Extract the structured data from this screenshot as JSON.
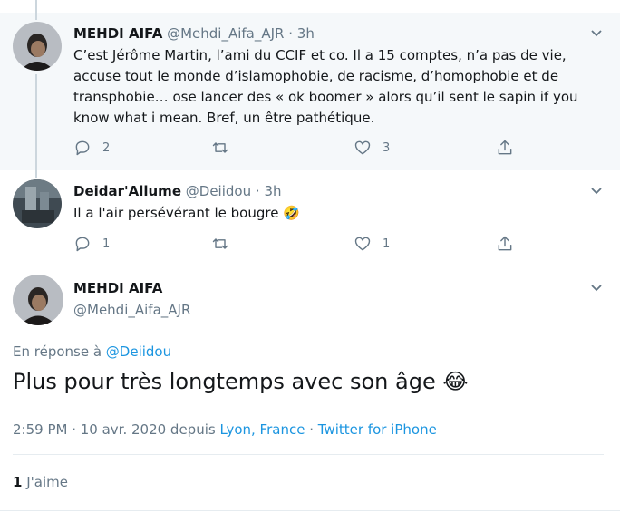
{
  "tweets": [
    {
      "name": "MEHDI AIFA",
      "handle": "@Mehdi_Aifa_AJR",
      "time": "3h",
      "text": "C’est Jérôme Martin, l’ami du CCIF et co. Il a 15 comptes, n’a pas de vie, accuse tout le monde d’islamophobie, de racisme, d’homophobie et de transphobie… ose lancer des « ok boomer » alors qu’il sent le sapin if you know what i mean. Bref, un être pathétique.",
      "replies": "2",
      "retweets": "",
      "likes": "3"
    },
    {
      "name": "Deidar'Allume",
      "handle": "@Deiidou",
      "time": "3h",
      "text": "Il a l'air persévérant le bougre",
      "emoji": "🤣",
      "replies": "1",
      "retweets": "",
      "likes": "1"
    }
  ],
  "main": {
    "name": "MEHDI AIFA",
    "handle": "@Mehdi_Aifa_AJR",
    "reply_prefix": "En réponse à ",
    "reply_mention": "@Deiidou",
    "text": "Plus pour très longtemps avec son âge",
    "emoji": "😂",
    "timestamp": "2:59 PM · 10 avr. 2020 depuis ",
    "location": "Lyon, France",
    "separator": " · ",
    "source": "Twitter for iPhone",
    "like_count": "1",
    "like_label": "J'aime"
  },
  "colors": {
    "accent": "#1b95e0",
    "muted": "#657786",
    "highlight_bg": "#f5f8fa"
  },
  "icons": [
    "reply-icon",
    "retweet-icon",
    "like-icon",
    "share-icon",
    "chevron-down-icon"
  ]
}
